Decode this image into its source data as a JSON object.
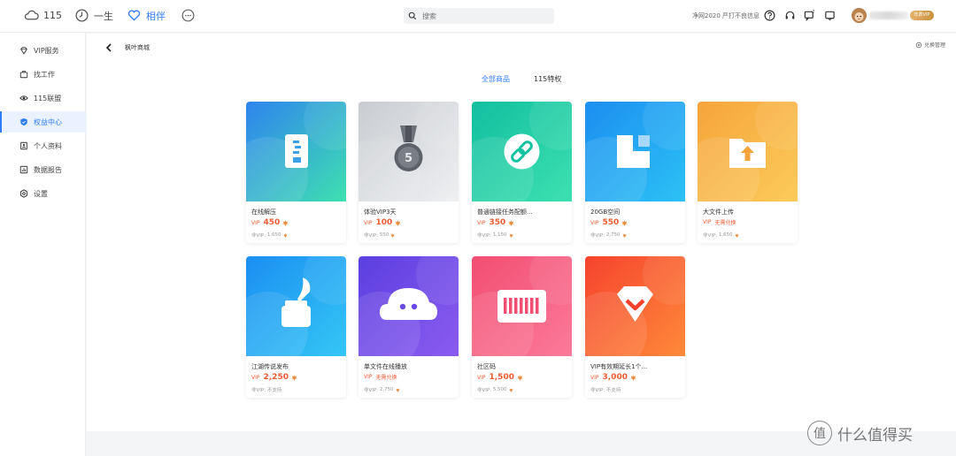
{
  "topnav": {
    "items": [
      {
        "label": "115",
        "icon": "cloud-icon"
      },
      {
        "label": "一生",
        "icon": "clock-icon"
      },
      {
        "label": "相伴",
        "icon": "heart-icon"
      },
      {
        "label": "",
        "icon": "more-icon"
      }
    ],
    "search_placeholder": "搜索",
    "notice": "净网2020 严打不良信息",
    "vip_tag": "年费VIP"
  },
  "sidebar": {
    "items": [
      {
        "label": "VIP服务",
        "icon": "diamond-icon"
      },
      {
        "label": "找工作",
        "icon": "briefcase-icon"
      },
      {
        "label": "115联盟",
        "icon": "eye-icon"
      },
      {
        "label": "权益中心",
        "icon": "shield-icon"
      },
      {
        "label": "个人资料",
        "icon": "profile-icon"
      },
      {
        "label": "数据报告",
        "icon": "report-icon"
      },
      {
        "label": "设置",
        "icon": "settings-icon"
      }
    ],
    "active_index": 3
  },
  "content": {
    "breadcrumb": "枫叶商城",
    "manage_label": "兑换管理",
    "tabs": [
      "全部商品",
      "115特权"
    ],
    "active_tab": 0
  },
  "products": [
    {
      "name": "在线解压",
      "vip_label": "VIP",
      "vip_price": "450",
      "normal_label": "非VIP:",
      "normal_price": "1,650",
      "icon": "zip-icon",
      "colors": [
        "#2f84ee",
        "#3ee0b0"
      ]
    },
    {
      "name": "体验VIP3天",
      "vip_label": "VIP",
      "vip_price": "100",
      "normal_label": "非VIP:",
      "normal_price": "550",
      "icon": "medal-icon",
      "colors": [
        "#c9ccd1",
        "#eef0f2"
      ]
    },
    {
      "name": "普通链接任务配额...",
      "vip_label": "VIP",
      "vip_price": "350",
      "normal_label": "非VIP:",
      "normal_price": "1,150",
      "icon": "link-icon",
      "colors": [
        "#12bfa0",
        "#3de0b0"
      ]
    },
    {
      "name": "20GB空间",
      "vip_label": "VIP",
      "vip_price": "550",
      "normal_label": "非VIP:",
      "normal_price": "2,750",
      "icon": "storage-icon",
      "colors": [
        "#1c8ff0",
        "#2cc1f5"
      ]
    },
    {
      "name": "大文件上传",
      "vip_label": "VIP",
      "vip_price": "无需兑换",
      "normal_label": "非VIP:",
      "normal_price": "1,650",
      "icon": "upload-folder-icon",
      "colors": [
        "#f6a43b",
        "#fccb5a"
      ]
    },
    {
      "name": "江湖传说发布",
      "vip_label": "VIP",
      "vip_price": "2,250",
      "normal_label": "非VIP:",
      "normal_price": "不支持",
      "icon": "ink-quill-icon",
      "colors": [
        "#1a8ff2",
        "#35c6f5"
      ]
    },
    {
      "name": "单文件在线播放",
      "vip_label": "VIP",
      "vip_price": "无需兑换",
      "normal_label": "非VIP:",
      "normal_price": "2,750",
      "icon": "cloud-play-icon",
      "colors": [
        "#5b3fe0",
        "#8b5cf0"
      ]
    },
    {
      "name": "社区码",
      "vip_label": "VIP",
      "vip_price": "1,500",
      "normal_label": "非VIP:",
      "normal_price": "5,500",
      "icon": "barcode-icon",
      "colors": [
        "#f24e72",
        "#fc7a9a"
      ]
    },
    {
      "name": "VIP有效期延长1个...",
      "vip_label": "VIP",
      "vip_price": "3,000",
      "normal_label": "非VIP:",
      "normal_price": "不支持",
      "icon": "vip-badge-icon",
      "colors": [
        "#f5432e",
        "#ff8a3a"
      ]
    }
  ],
  "watermark": {
    "symbol": "值",
    "text": "什么值得买"
  },
  "accent_color": "#2f7cf6",
  "price_color": "#ef5a32"
}
